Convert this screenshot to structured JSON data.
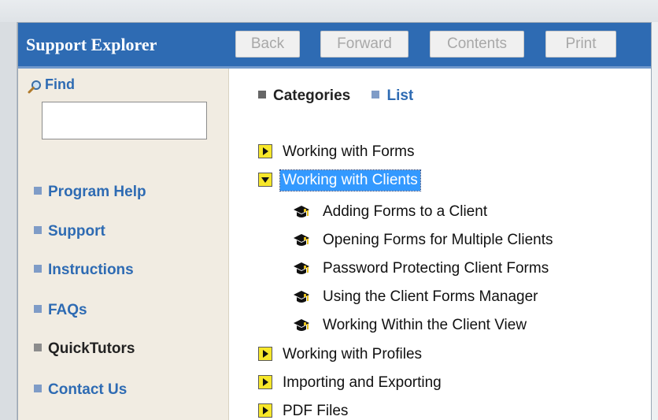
{
  "header": {
    "title": "Support Explorer",
    "buttons": {
      "back": "Back",
      "forward": "Forward",
      "contents": "Contents",
      "print": "Print"
    }
  },
  "sidebar": {
    "find_label": "Find",
    "find_value": "",
    "items": [
      {
        "label": "Program Help",
        "active": false
      },
      {
        "label": "Support",
        "active": false
      },
      {
        "label": "Instructions",
        "active": false
      },
      {
        "label": "FAQs",
        "active": false
      },
      {
        "label": "QuickTutors",
        "active": true
      },
      {
        "label": "Contact Us",
        "active": false
      }
    ]
  },
  "tabs": {
    "categories": "Categories",
    "list": "List"
  },
  "tree": {
    "items": [
      {
        "label": "Working with Forms",
        "expanded": false
      },
      {
        "label": "Working with Clients",
        "expanded": true,
        "selected": true
      },
      {
        "label": "Working with Profiles",
        "expanded": false
      },
      {
        "label": "Importing and Exporting",
        "expanded": false
      },
      {
        "label": "PDF Files",
        "expanded": false
      }
    ],
    "children": [
      "Adding Forms to a Client",
      "Opening Forms for Multiple Clients",
      "Password Protecting Client Forms",
      "Using the Client Forms Manager",
      "Working Within the Client View"
    ]
  },
  "colors": {
    "header_bg": "#2e6bb3",
    "sidebar_bg": "#f1ece2",
    "link_blue": "#2e6bb3",
    "selection": "#3399ff",
    "expander_yellow": "#f7e72a"
  },
  "icons": {
    "find": "magnifier-icon",
    "tree_collapsed": "expand-arrow-icon",
    "tree_expanded": "collapse-arrow-icon",
    "tutorial": "graduation-cap-icon"
  }
}
